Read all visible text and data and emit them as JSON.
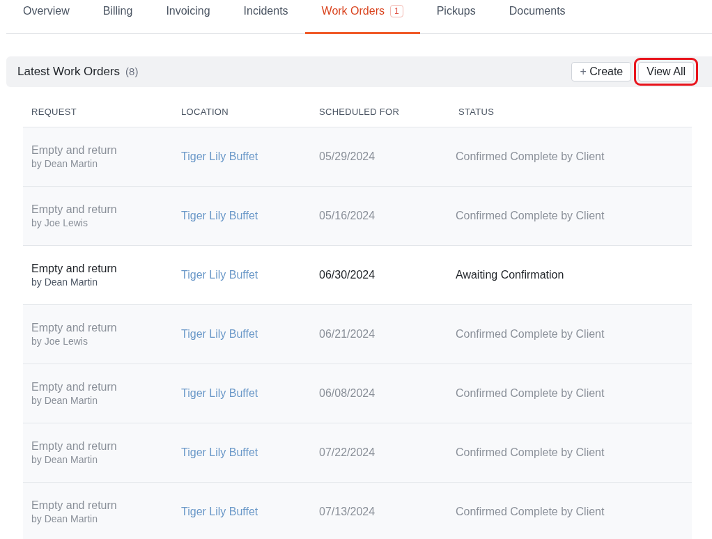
{
  "tabs": [
    {
      "label": "Overview",
      "selected": false
    },
    {
      "label": "Billing",
      "selected": false
    },
    {
      "label": "Invoicing",
      "selected": false
    },
    {
      "label": "Incidents",
      "selected": false
    },
    {
      "label": "Work Orders",
      "selected": true,
      "badge": "1"
    },
    {
      "label": "Pickups",
      "selected": false
    },
    {
      "label": "Documents",
      "selected": false
    }
  ],
  "section": {
    "title": "Latest Work Orders",
    "count": "(8)",
    "create_button": {
      "icon": "+",
      "label": "Create"
    },
    "view_all_button": {
      "label": "View All",
      "highlighted": true
    }
  },
  "table": {
    "columns": [
      "REQUEST",
      "LOCATION",
      "SCHEDULED FOR",
      "STATUS"
    ],
    "rows": [
      {
        "request": "Empty and return",
        "by": "by Dean Martin",
        "location": "Tiger Lily Buffet",
        "scheduled": "05/29/2024",
        "status": "Confirmed Complete by Client",
        "muted": true
      },
      {
        "request": "Empty and return",
        "by": "by Joe Lewis",
        "location": "Tiger Lily Buffet",
        "scheduled": "05/16/2024",
        "status": "Confirmed Complete by Client",
        "muted": true
      },
      {
        "request": "Empty and return",
        "by": "by Dean Martin",
        "location": "Tiger Lily Buffet",
        "scheduled": "06/30/2024",
        "status": "Awaiting Confirmation",
        "muted": false
      },
      {
        "request": "Empty and return",
        "by": "by Joe Lewis",
        "location": "Tiger Lily Buffet",
        "scheduled": "06/21/2024",
        "status": "Confirmed Complete by Client",
        "muted": true
      },
      {
        "request": "Empty and return",
        "by": "by Dean Martin",
        "location": "Tiger Lily Buffet",
        "scheduled": "06/08/2024",
        "status": "Confirmed Complete by Client",
        "muted": true
      },
      {
        "request": "Empty and return",
        "by": "by Dean Martin",
        "location": "Tiger Lily Buffet",
        "scheduled": "07/22/2024",
        "status": "Confirmed Complete by Client",
        "muted": true
      },
      {
        "request": "Empty and return",
        "by": "by Dean Martin",
        "location": "Tiger Lily Buffet",
        "scheduled": "07/13/2024",
        "status": "Confirmed Complete by Client",
        "muted": true
      }
    ]
  }
}
